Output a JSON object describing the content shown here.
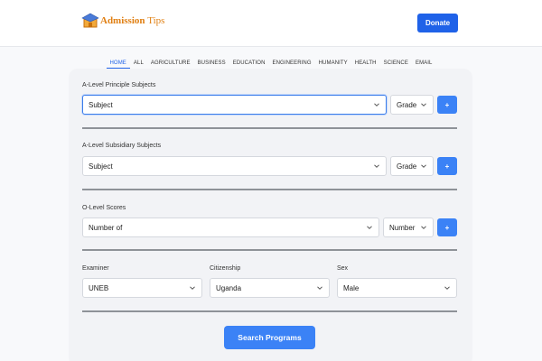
{
  "brand": {
    "name_part1": "Admission",
    "name_part2": "Tips"
  },
  "header": {
    "donate_label": "Donate"
  },
  "nav": [
    "HOME",
    "ALL",
    "AGRICULTURE",
    "BUSINESS",
    "EDUCATION",
    "ENGINEERING",
    "HUMANITY",
    "HEALTH",
    "SCIENCE",
    "EMAIL"
  ],
  "principal": {
    "label": "A-Level Principle Subjects",
    "subject": "Subject",
    "grade": "Grade",
    "add": "+"
  },
  "subsidiary": {
    "label": "A-Level Subsidiary Subjects",
    "subject": "Subject",
    "grade": "Grade",
    "add": "+"
  },
  "olevel": {
    "label": "O-Level Scores",
    "subject": "Number of",
    "number": "Number",
    "add": "+"
  },
  "filters": {
    "examiner_label": "Examiner",
    "examiner_value": "UNEB",
    "citizenship_label": "Citizenship",
    "citizenship_value": "Uganda",
    "sex_label": "Sex",
    "sex_value": "Male"
  },
  "search_label": "Search Programs",
  "colors": {
    "accent": "#3b82f6",
    "donate": "#1f62e8",
    "brand": "#e07f12"
  }
}
